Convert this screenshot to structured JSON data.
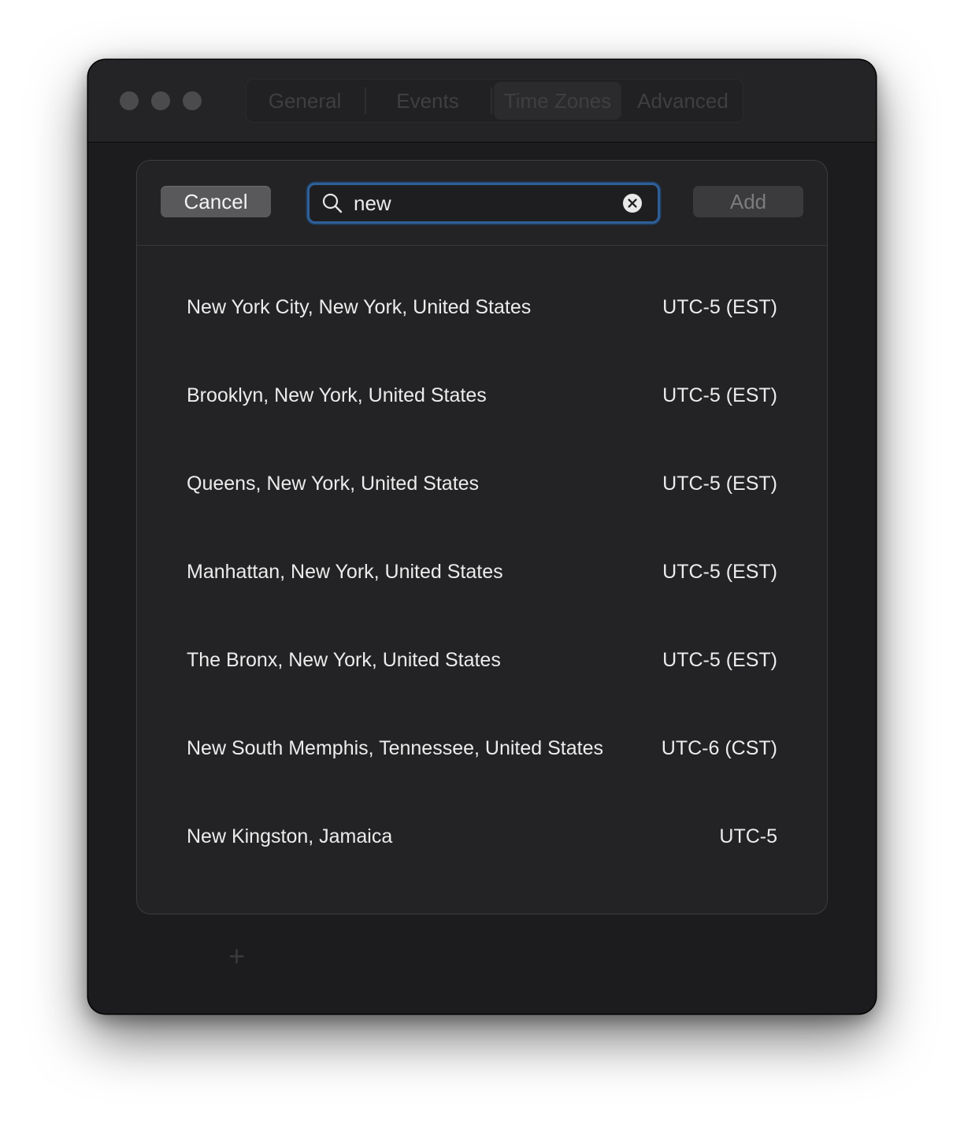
{
  "window": {
    "tabs": [
      {
        "label": "General"
      },
      {
        "label": "Events"
      },
      {
        "label": "Time Zones"
      },
      {
        "label": "Advanced"
      }
    ],
    "selected_tab": "Time Zones",
    "add_glyph": "+"
  },
  "sheet": {
    "cancel_label": "Cancel",
    "add_label": "Add",
    "search": {
      "value": "new",
      "icon": "search-icon",
      "clear_icon": "clear-icon"
    },
    "results": [
      {
        "city": "New York City, New York, United States",
        "tz": "UTC-5 (EST)"
      },
      {
        "city": "Brooklyn, New York, United States",
        "tz": "UTC-5 (EST)"
      },
      {
        "city": "Queens, New York, United States",
        "tz": "UTC-5 (EST)"
      },
      {
        "city": "Manhattan, New York, United States",
        "tz": "UTC-5 (EST)"
      },
      {
        "city": "The Bronx, New York, United States",
        "tz": "UTC-5 (EST)"
      },
      {
        "city": "New South Memphis, Tennessee, United States",
        "tz": "UTC-6 (CST)"
      },
      {
        "city": "New Kingston, Jamaica",
        "tz": "UTC-5"
      }
    ]
  },
  "colors": {
    "window_bg": "#1c1c1e",
    "sheet_bg": "#232325",
    "focus_ring": "#2f5f97",
    "text": "#ececec"
  }
}
